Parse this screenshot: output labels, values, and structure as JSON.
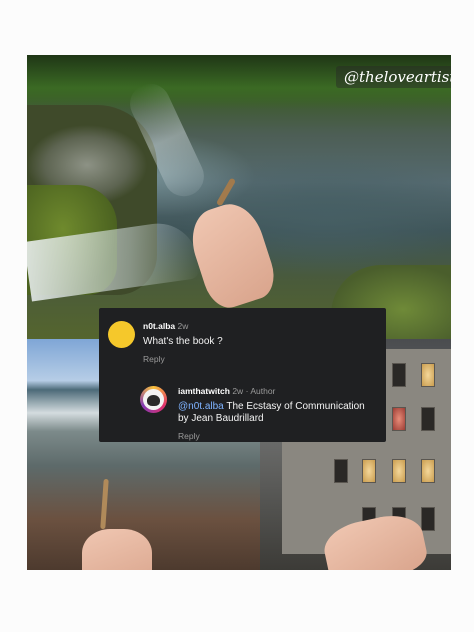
{
  "watermark": "@theloveartist",
  "comments": [
    {
      "username": "n0t.alba",
      "time": "2w",
      "text": "What's the book ?",
      "reply_label": "Reply",
      "avatar": "yellow-circle-avatar"
    },
    {
      "username": "iamthatwitch",
      "time": "2w",
      "separator": "·",
      "badge": "Author",
      "mention": "@n0t.alba",
      "text_line1": "The Ecstasy of Communication",
      "text_line2": "by Jean Baudrillard",
      "reply_label": "Reply",
      "avatar": "profile-photo-avatar"
    }
  ],
  "colors": {
    "card_background": "#1f2022",
    "mention": "#7fb3ff",
    "muted_text": "#9a9a9a",
    "page_background": "#fcfcfc"
  }
}
